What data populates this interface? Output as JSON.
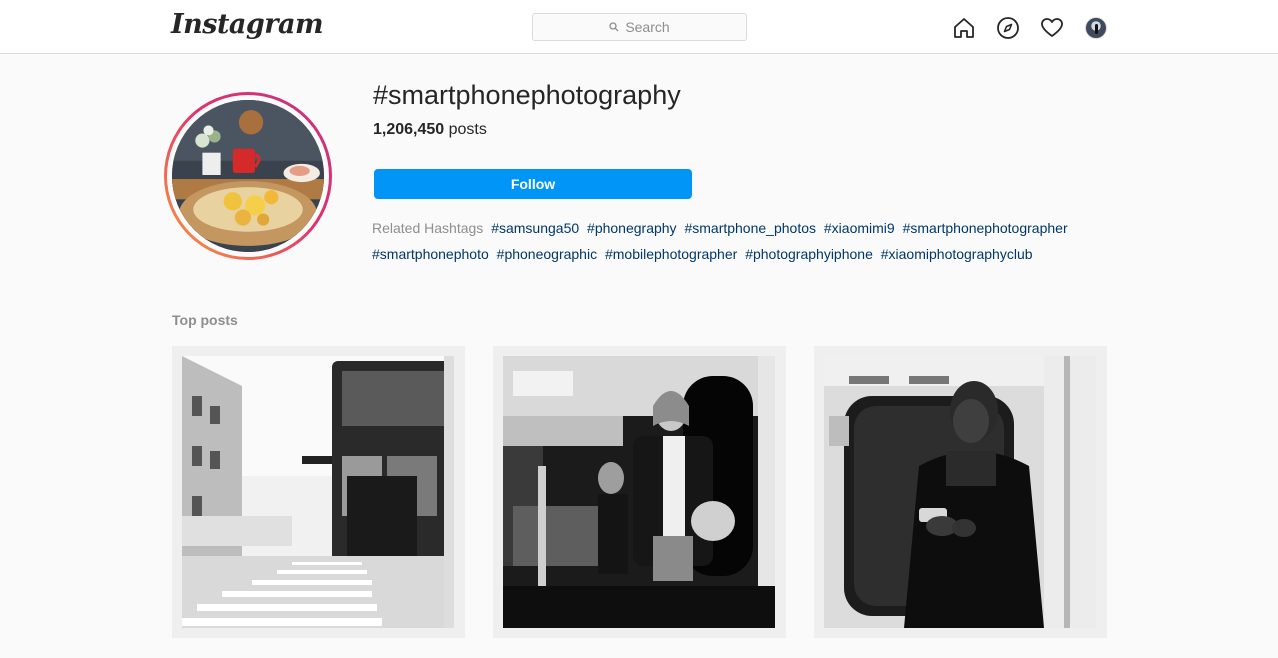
{
  "nav": {
    "logo": "Instagram",
    "search_placeholder": "Search",
    "icons": [
      "home-icon",
      "explore-icon",
      "activity-heart-icon",
      "profile-avatar"
    ]
  },
  "header": {
    "hashtag": "#smartphonephotography",
    "post_count": "1,206,450",
    "post_label": " posts",
    "follow_label": "Follow"
  },
  "related": {
    "label": "Related Hashtags",
    "tags": [
      "#samsunga50",
      "#phonegraphy",
      "#smartphone_photos",
      "#xiaomimi9",
      "#smartphonephotographer",
      "#smartphonephoto",
      "#phoneographic",
      "#mobilephotographer",
      "#photographyiphone",
      "#xiaomiphotographyclub"
    ]
  },
  "top_posts": {
    "label": "Top posts",
    "posts": [
      {
        "alt": "black and white photo of double-decker bus at crosswalk"
      },
      {
        "alt": "black and white photo of woman standing on subway train"
      },
      {
        "alt": "black and white photo of man looking at phone on subway"
      }
    ]
  },
  "colors": {
    "accent": "#0095f6",
    "link": "#00376b",
    "muted": "#8e8e8e"
  }
}
